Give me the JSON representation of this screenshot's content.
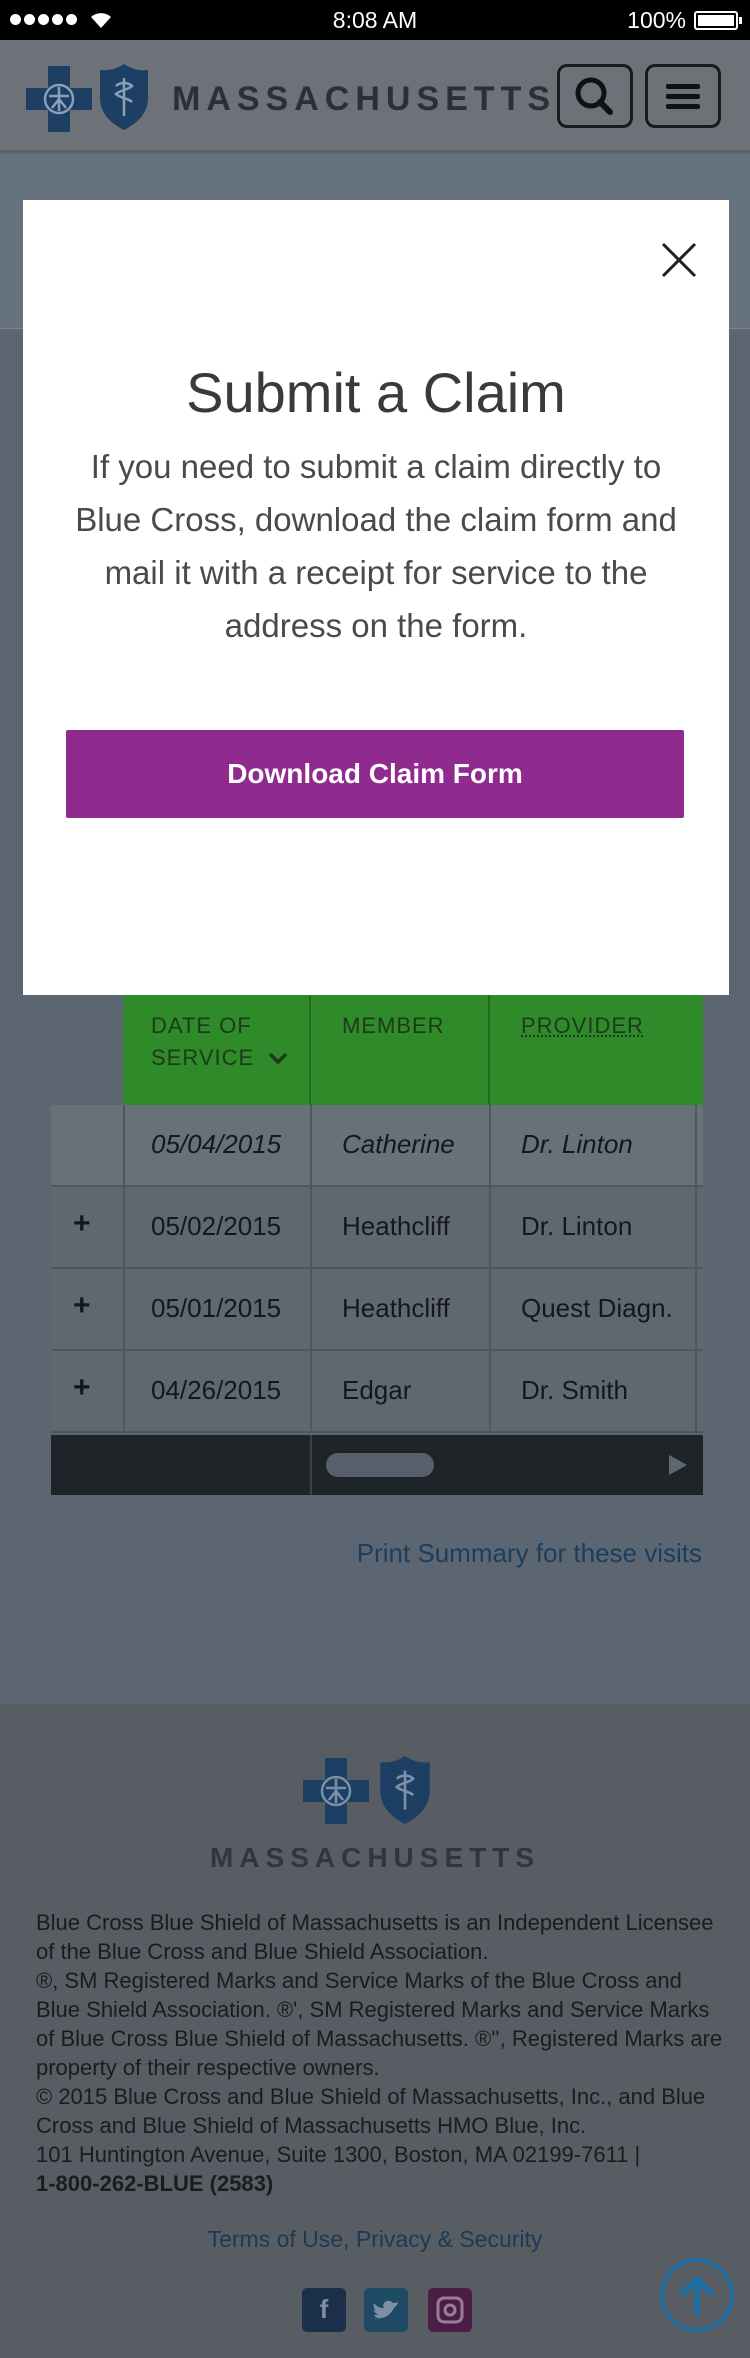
{
  "status_bar": {
    "time": "8:08 AM",
    "battery": "100%"
  },
  "header": {
    "brand": "MASSACHUSETTS",
    "search_icon": "search-icon",
    "menu_icon": "hamburger-menu-icon"
  },
  "modal": {
    "title": "Submit a Claim",
    "body": "If you need to submit a claim directly to Blue Cross, download the claim form and mail it with a receipt for service to the address on the form.",
    "button_label": "Download Claim Form",
    "close_icon": "close-icon"
  },
  "table": {
    "headers": {
      "date": "DATE OF SERVICE",
      "member": "MEMBER",
      "provider": "PROVIDER"
    },
    "rows": [
      {
        "expand": "",
        "date": "05/04/2015",
        "member": "Catherine",
        "provider": "Dr. Linton"
      },
      {
        "expand": "+",
        "date": "05/02/2015",
        "member": "Heathcliff",
        "provider": "Dr. Linton"
      },
      {
        "expand": "+",
        "date": "05/01/2015",
        "member": "Heathcliff",
        "provider": "Quest Diagn."
      },
      {
        "expand": "+",
        "date": "04/26/2015",
        "member": "Edgar",
        "provider": "Dr. Smith"
      }
    ]
  },
  "print_link": "Print Summary for these visits",
  "footer": {
    "brand": "MASSACHUSETTS",
    "para1": "Blue Cross Blue Shield of Massachusetts is an Independent Licensee of the Blue Cross and Blue Shield Association.",
    "para2": "®, SM Registered Marks and Service Marks of the Blue Cross and Blue Shield Association. ®', SM Registered Marks and Service Marks of Blue Cross Blue Shield of Massachusetts. ®'', Registered Marks are property of their respective owners.",
    "para3": "© 2015 Blue Cross and Blue Shield of Massachusetts, Inc., and Blue Cross and Blue Shield of Massachusetts HMO Blue, Inc.",
    "address": "101 Huntington Avenue, Suite 1300, Boston, MA 02199-7611 |",
    "phone": "1-800-262-BLUE (2583)",
    "links": "Terms of Use, Privacy & Security",
    "social": [
      "facebook-icon",
      "twitter-icon",
      "instagram-icon"
    ],
    "to_top_icon": "arrow-up-circle-icon"
  }
}
